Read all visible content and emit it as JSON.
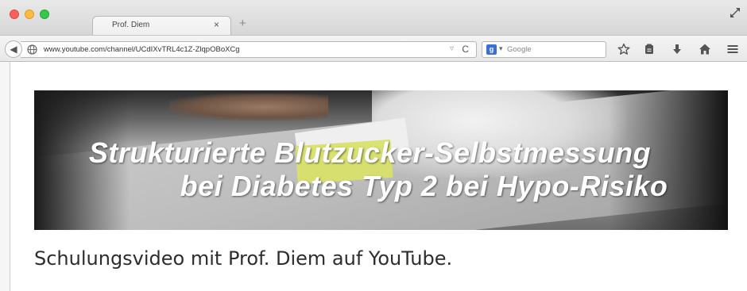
{
  "browser": {
    "tab_title": "Prof. Diem",
    "tab_close_glyph": "×",
    "new_tab_glyph": "+",
    "url": "www.youtube.com/channel/UCdIXvTRL4c1Z-ZlqpOBoXCg",
    "url_dropdown_glyph": "▿",
    "reload_glyph": "C",
    "search_placeholder": "Google",
    "search_engine_letter": "g",
    "search_dropdown_glyph": "▾",
    "back_glyph": "◀"
  },
  "banner": {
    "line1": "Strukturierte Blutzucker-Selbstmessung",
    "line2": "bei Diabetes Typ 2 bei Hypo-Risiko"
  },
  "caption": "Schulungsvideo mit Prof. Diem auf YouTube.",
  "colors": {
    "close": "#fc605c",
    "minimize": "#fdbc40",
    "maximize": "#34c84a"
  },
  "icons": [
    "globe-icon",
    "bookmark-star-icon",
    "reading-list-icon",
    "download-icon",
    "home-icon",
    "menu-icon",
    "fullscreen-icon"
  ]
}
